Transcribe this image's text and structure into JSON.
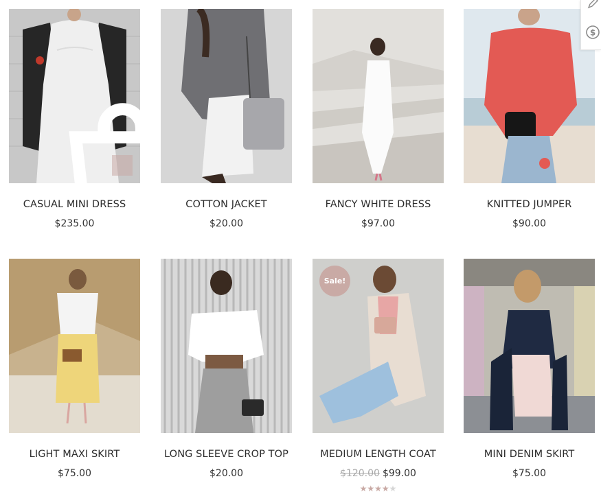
{
  "products": [
    {
      "name": "CASUAL MINI DRESS",
      "price": "$235.00"
    },
    {
      "name": "COTTON JACKET",
      "price": "$20.00"
    },
    {
      "name": "FANCY WHITE DRESS",
      "price": "$97.00"
    },
    {
      "name": "KNITTED JUMPER",
      "price": "$90.00"
    },
    {
      "name": "LIGHT MAXI SKIRT",
      "price": "$75.00"
    },
    {
      "name": "LONG SLEEVE CROP TOP",
      "price": "$20.00"
    },
    {
      "name": "MEDIUM LENGTH COAT",
      "old_price": "$120.00",
      "price": "$99.00",
      "badge": "Sale!",
      "rating": 4
    },
    {
      "name": "MINI DENIM SKIRT",
      "price": "$75.00"
    }
  ],
  "icons": {
    "add_to_cart": "shopping-bag-icon",
    "edit": "pencil-icon",
    "currency": "dollar-coin-icon"
  },
  "colors": {
    "accent": "#c9aaa5",
    "text": "#2b2b2b",
    "muted": "#a9a9a9"
  }
}
